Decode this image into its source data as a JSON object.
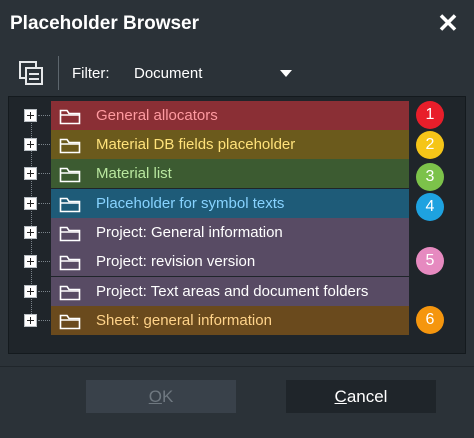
{
  "window": {
    "title": "Placeholder Browser",
    "close_glyph": "✕"
  },
  "toolbar": {
    "icon": "copy-window-icon",
    "filter_label": "Filter:",
    "filter_value": "Document"
  },
  "rows": [
    {
      "label": "General allocators",
      "color": "#8a2f35",
      "text_color": "#ff9aa0",
      "icon": "folder-icon",
      "expander": "plus-expander-icon"
    },
    {
      "label": "Material DB fields placeholder",
      "color": "#6b5a1c",
      "text_color": "#ffe27a",
      "icon": "folder-icon",
      "expander": "plus-expander-icon"
    },
    {
      "label": "Material list",
      "color": "#3c5b31",
      "text_color": "#b9e89f",
      "icon": "folder-icon",
      "expander": "plus-expander-icon"
    },
    {
      "label": "Placeholder for symbol texts",
      "color": "#1e5b78",
      "text_color": "#87d3ff",
      "icon": "folder-icon",
      "expander": "plus-expander-icon"
    },
    {
      "label": "Project: General information",
      "color": "#584b64",
      "text_color": "#ffffff",
      "icon": "folder-icon",
      "expander": "plus-expander-icon"
    },
    {
      "label": "Project: revision version",
      "color": "#584b64",
      "text_color": "#ffffff",
      "icon": "folder-icon",
      "expander": "plus-expander-icon"
    },
    {
      "label": "Project: Text areas and document folders",
      "color": "#584b64",
      "text_color": "#ffffff",
      "icon": "folder-icon",
      "expander": "plus-expander-icon"
    },
    {
      "label": "Sheet: general information",
      "color": "#6a4a1d",
      "text_color": "#ffd38a",
      "icon": "folder-icon",
      "expander": "plus-expander-icon"
    }
  ],
  "badges": [
    {
      "number": "1",
      "color": "#e81e2a"
    },
    {
      "number": "2",
      "color": "#f5c518"
    },
    {
      "number": "3",
      "color": "#7cc24a"
    },
    {
      "number": "4",
      "color": "#1ea2e0"
    },
    {
      "number": "5",
      "color": "#e68ac0"
    },
    {
      "number": "6",
      "color": "#f5960e"
    }
  ],
  "buttons": {
    "ok": {
      "label": "OK",
      "mnemonic": "O",
      "enabled": false
    },
    "cancel": {
      "label": "Cancel",
      "mnemonic": "C",
      "enabled": true
    }
  }
}
